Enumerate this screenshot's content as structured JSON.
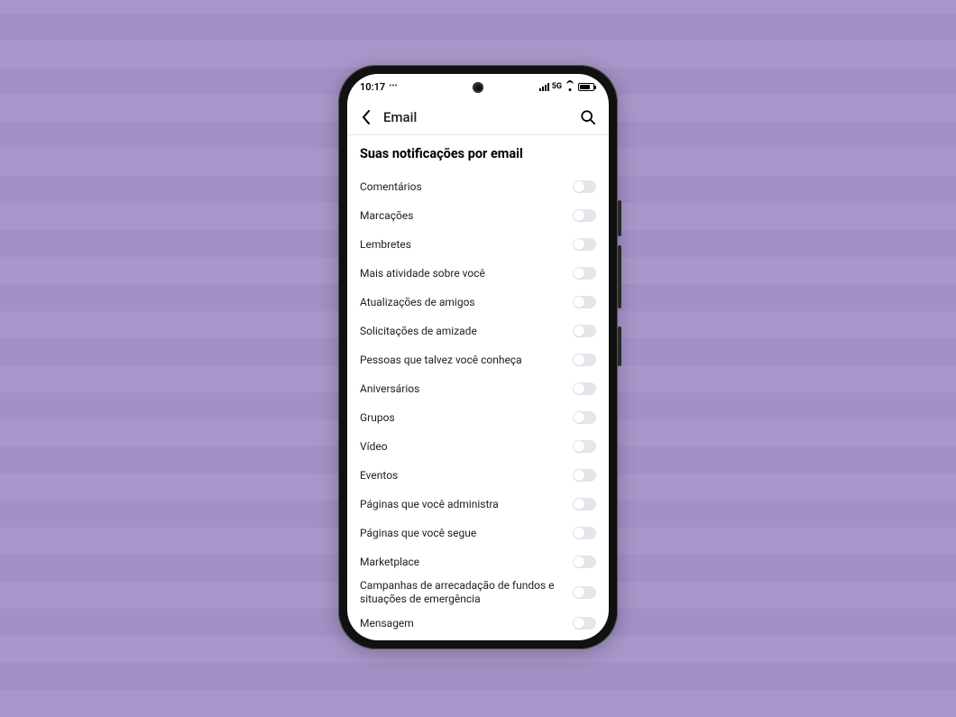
{
  "status": {
    "time": "10:17",
    "network_label": "5G"
  },
  "header": {
    "title": "Email"
  },
  "section_title": "Suas notificações por email",
  "items": [
    {
      "label": "Comentários",
      "on": false
    },
    {
      "label": "Marcações",
      "on": false
    },
    {
      "label": "Lembretes",
      "on": false
    },
    {
      "label": "Mais atividade sobre você",
      "on": false
    },
    {
      "label": "Atualizações de amigos",
      "on": false
    },
    {
      "label": "Solicitações de amizade",
      "on": false
    },
    {
      "label": "Pessoas que talvez você conheça",
      "on": false
    },
    {
      "label": "Aniversários",
      "on": false
    },
    {
      "label": "Grupos",
      "on": false
    },
    {
      "label": "Vídeo",
      "on": false
    },
    {
      "label": "Eventos",
      "on": false
    },
    {
      "label": "Páginas que você administra",
      "on": false
    },
    {
      "label": "Páginas que você segue",
      "on": false
    },
    {
      "label": "Marketplace",
      "on": false
    },
    {
      "label": "Campanhas de arrecadação de fundos e situações de emergência",
      "on": false
    },
    {
      "label": "Mensagem",
      "on": false
    }
  ]
}
